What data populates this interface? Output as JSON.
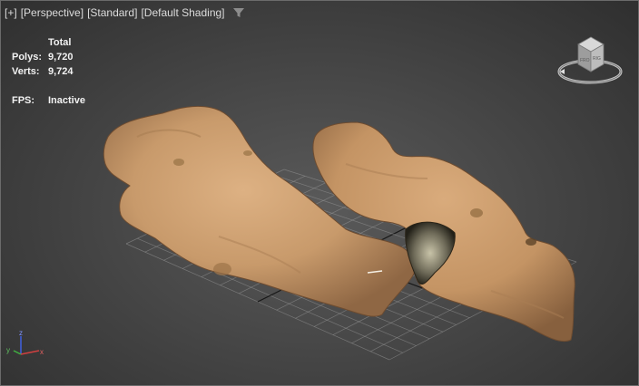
{
  "viewport": {
    "labels": [
      "[+]",
      "[Perspective]",
      "[Standard]",
      "[Default Shading]"
    ],
    "filter_icon": "funnel-icon"
  },
  "stats": {
    "title": "Total",
    "polys_label": "Polys:",
    "polys_value": "9,720",
    "verts_label": "Verts:",
    "verts_value": "9,724",
    "fps_label": "FPS:",
    "fps_value": "Inactive"
  },
  "viewcube": {
    "face_front": "FRO",
    "face_right": "RIG"
  },
  "axes": {
    "x": "x",
    "y": "y",
    "z": "z",
    "x_color": "#d04040",
    "y_color": "#40b040",
    "z_color": "#4060e0"
  },
  "colors": {
    "background_center": "#5a5a5a",
    "grid": "#9a9a9a",
    "grid_center": "#111111",
    "model_skin": "#c79a6c"
  }
}
